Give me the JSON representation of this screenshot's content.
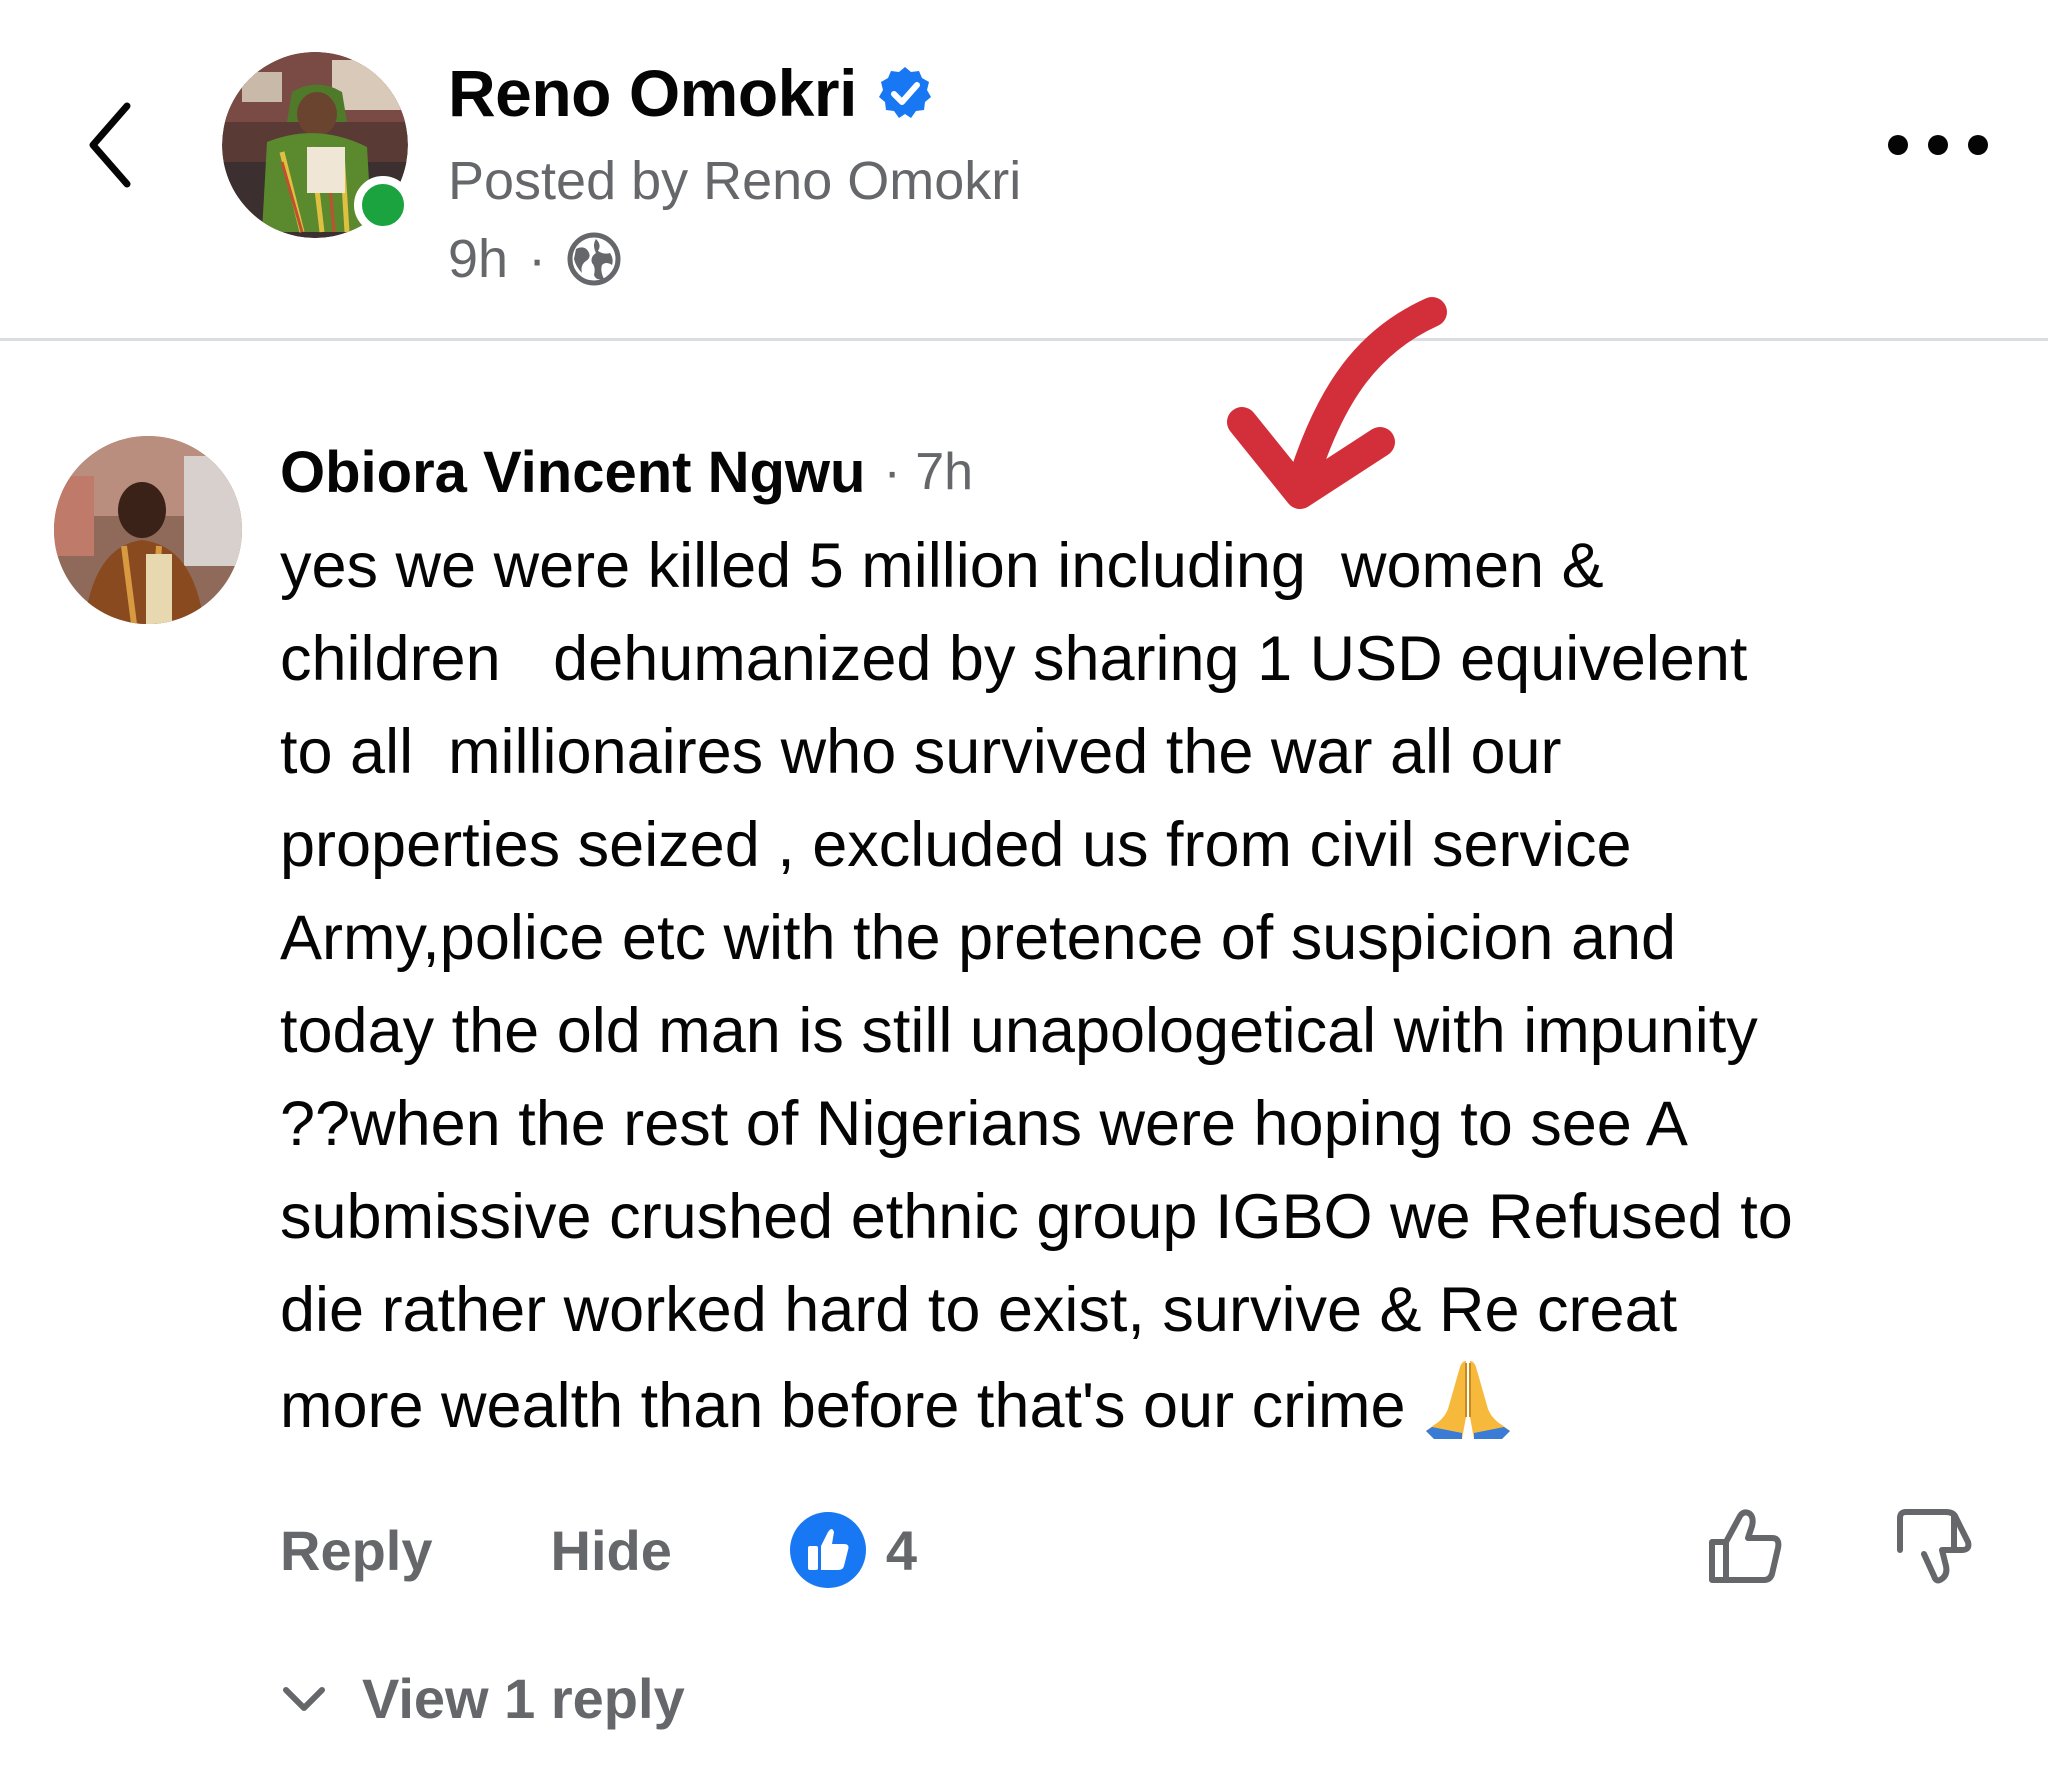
{
  "header": {
    "page_name": "Reno Omokri",
    "posted_by": "Posted by Reno Omokri",
    "time": "9h",
    "separator": "·"
  },
  "comment": {
    "author": "Obiora Vincent Ngwu",
    "time": "· 7h",
    "lines": [
      "yes we were killed 5 million including  women &",
      "children   dehumanized by sharing 1 USD equivelent",
      "to all  millionaires who survived the war all our",
      "properties seized , excluded us from civil service",
      "Army,police etc with the pretence of suspicion and",
      "today the old man is still unapologetical with impunity",
      "??when the rest of Nigerians were hoping to see A",
      "submissive crushed ethnic group IGBO we Refused to",
      "die rather worked hard to exist, survive & Re creat",
      "more wealth than before that's our crime"
    ],
    "actions": {
      "reply": "Reply",
      "hide": "Hide",
      "reaction_count": "4"
    },
    "view_replies": "View 1 reply"
  },
  "colors": {
    "accent": "#1877f2",
    "online": "#1ba340",
    "secondary_text": "#65676b",
    "annotation_arrow": "#d32f3a"
  },
  "icons": {
    "back": "chevron-left-icon",
    "verified": "verified-badge-icon",
    "audience": "globe-icon",
    "more": "more-horizontal-icon",
    "like": "thumbs-up-icon",
    "dislike": "thumbs-down-icon",
    "emoji": "folded-hands-emoji",
    "expand": "chevron-down-icon"
  }
}
